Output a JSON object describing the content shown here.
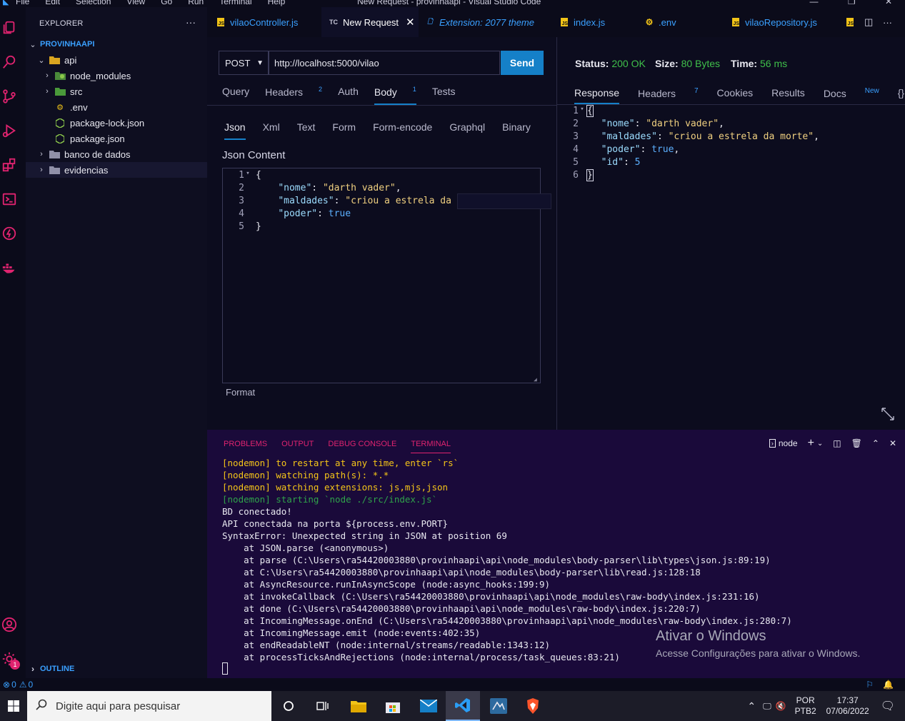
{
  "window": {
    "title": "New Request - provinhaapi - Visual Studio Code",
    "menu": [
      "File",
      "Edit",
      "Selection",
      "View",
      "Go",
      "Run",
      "Terminal",
      "Help"
    ]
  },
  "sidebar": {
    "header": "EXPLORER",
    "more": "···",
    "project": "PROVINHAAPI",
    "items": [
      {
        "label": "api"
      },
      {
        "label": "node_modules"
      },
      {
        "label": "src"
      },
      {
        "label": ".env"
      },
      {
        "label": "package-lock.json"
      },
      {
        "label": "package.json"
      },
      {
        "label": "banco de dados"
      },
      {
        "label": "evidencias"
      }
    ],
    "outline": "OUTLINE"
  },
  "tabs": [
    {
      "label": "vilaoController.js"
    },
    {
      "label": "New Request",
      "icon_text": "TC"
    },
    {
      "label": "Extension: 2077 theme"
    },
    {
      "label": "index.js"
    },
    {
      "label": ".env"
    },
    {
      "label": "vilaoRepository.js"
    }
  ],
  "request": {
    "method": "POST",
    "url": "http://localhost:5000/vilao",
    "send_label": "Send",
    "tabs": {
      "query": "Query",
      "headers": "Headers",
      "headers_count": "2",
      "auth": "Auth",
      "body": "Body",
      "body_count": "1",
      "tests": "Tests"
    },
    "body_tabs": [
      "Json",
      "Xml",
      "Text",
      "Form",
      "Form-encode",
      "Graphql",
      "Binary"
    ],
    "json_label": "Json Content",
    "code": {
      "l1": "{",
      "l2_key": "\"nome\"",
      "l2_val": "\"darth vader\"",
      "l3_key": "\"maldades\"",
      "l3_val": "\"criou a estrela da morte\"",
      "l4_key": "\"poder\"",
      "l4_val": "true",
      "l5": "}"
    },
    "format_label": "Format"
  },
  "response": {
    "status_label": "Status:",
    "status_value": "200 OK",
    "size_label": "Size:",
    "size_value": "80 Bytes",
    "time_label": "Time:",
    "time_value": "56 ms",
    "tabs": {
      "response": "Response",
      "headers": "Headers",
      "headers_count": "7",
      "cookies": "Cookies",
      "results": "Results",
      "docs": "Docs",
      "docs_badge": "New",
      "braces": "{}"
    },
    "code": {
      "l1": "{",
      "l2_key": "\"nome\"",
      "l2_val": "\"darth vader\"",
      "l3_key": "\"maldades\"",
      "l3_val": "\"criou a estrela da morte\"",
      "l4_key": "\"poder\"",
      "l4_val": "true",
      "l5_key": "\"id\"",
      "l5_val": "5",
      "l6": "}"
    }
  },
  "panel": {
    "tabs": [
      "PROBLEMS",
      "OUTPUT",
      "DEBUG CONSOLE",
      "TERMINAL"
    ],
    "shell": "node",
    "terminal_lines": [
      {
        "text": "[nodemon] to restart at any time, enter `rs`",
        "color": "#f5c518"
      },
      {
        "text": "[nodemon] watching path(s): *.*",
        "color": "#f5c518"
      },
      {
        "text": "[nodemon] watching extensions: js,mjs,json",
        "color": "#f5c518"
      },
      {
        "text": "[nodemon] starting `node ./src/index.js`",
        "color": "#2fa34a"
      },
      {
        "text": "BD conectado!",
        "color": "#e8e8f0"
      },
      {
        "text": "API conectada na porta ${process.env.PORT}",
        "color": "#e8e8f0"
      },
      {
        "text": "SyntaxError: Unexpected string in JSON at position 69",
        "color": "#e8e8f0"
      },
      {
        "text": "    at JSON.parse (<anonymous>)",
        "color": "#e8e8f0"
      },
      {
        "text": "    at parse (C:\\Users\\ra54420003880\\provinhaapi\\api\\node_modules\\body-parser\\lib\\types\\json.js:89:19)",
        "color": "#e8e8f0"
      },
      {
        "text": "    at C:\\Users\\ra54420003880\\provinhaapi\\api\\node_modules\\body-parser\\lib\\read.js:128:18",
        "color": "#e8e8f0"
      },
      {
        "text": "    at AsyncResource.runInAsyncScope (node:async_hooks:199:9)",
        "color": "#e8e8f0"
      },
      {
        "text": "    at invokeCallback (C:\\Users\\ra54420003880\\provinhaapi\\api\\node_modules\\raw-body\\index.js:231:16)",
        "color": "#e8e8f0"
      },
      {
        "text": "    at done (C:\\Users\\ra54420003880\\provinhaapi\\api\\node_modules\\raw-body\\index.js:220:7)",
        "color": "#e8e8f0"
      },
      {
        "text": "    at IncomingMessage.onEnd (C:\\Users\\ra54420003880\\provinhaapi\\api\\node_modules\\raw-body\\index.js:280:7)",
        "color": "#e8e8f0"
      },
      {
        "text": "    at IncomingMessage.emit (node:events:402:35)",
        "color": "#e8e8f0"
      },
      {
        "text": "    at endReadableNT (node:internal/streams/readable:1343:12)",
        "color": "#e8e8f0"
      },
      {
        "text": "    at processTicksAndRejections (node:internal/process/task_queues:83:21)",
        "color": "#e8e8f0"
      }
    ],
    "watermark_title": "Ativar o Windows",
    "watermark_sub": "Acesse Configurações para ativar o Windows."
  },
  "statusbar": {
    "errors": "0",
    "warnings": "0",
    "accounts_badge": "1"
  },
  "taskbar": {
    "search_placeholder": "Digite aqui para pesquisar",
    "lang": "POR",
    "layout": "PTB2",
    "time": "17:37",
    "date": "07/06/2022"
  },
  "colors": {
    "accent_pink": "#e0236f",
    "accent_blue": "#3aa0ff",
    "send_button": "#1580c8",
    "status_green": "#3fbf4a",
    "terminal_bg": "#1a0a3a",
    "nodemon_yellow": "#f5c518"
  }
}
